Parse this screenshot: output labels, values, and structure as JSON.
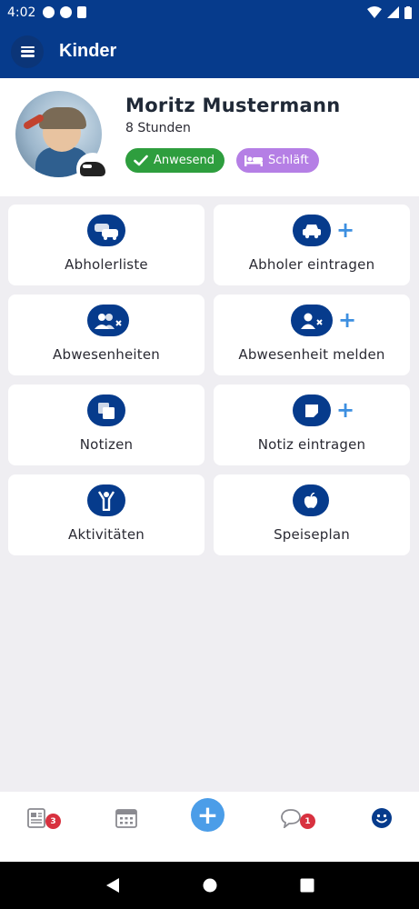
{
  "status_bar": {
    "time": "4:02"
  },
  "app_bar": {
    "title": "Kinder",
    "menu_icon": "menu-icon"
  },
  "profile": {
    "name": "Moritz Mustermann",
    "subtitle": "8 Stunden",
    "status_chips": [
      {
        "label": "Anwesend",
        "icon": "check-icon",
        "color": "#2e9e3e"
      },
      {
        "label": "Schläft",
        "icon": "bed-icon",
        "color": "#b57fe5"
      }
    ]
  },
  "tiles": [
    {
      "label": "Abholerliste",
      "icon": "cars-icon",
      "has_plus": false
    },
    {
      "label": "Abholer eintragen",
      "icon": "car-icon",
      "has_plus": true
    },
    {
      "label": "Abwesenheiten",
      "icon": "users-x-icon",
      "has_plus": false
    },
    {
      "label": "Abwesenheit melden",
      "icon": "user-x-icon",
      "has_plus": true
    },
    {
      "label": "Notizen",
      "icon": "notes-icon",
      "has_plus": false
    },
    {
      "label": "Notiz eintragen",
      "icon": "note-icon",
      "has_plus": true
    },
    {
      "label": "Aktivitäten",
      "icon": "child-activity-icon",
      "has_plus": false
    },
    {
      "label": "Speiseplan",
      "icon": "apple-icon",
      "has_plus": false
    }
  ],
  "bottom_nav": [
    {
      "icon": "newspaper-icon",
      "badge": "3"
    },
    {
      "icon": "calendar-icon",
      "badge": ""
    },
    {
      "icon": "plus-icon",
      "badge": ""
    },
    {
      "icon": "chat-icon",
      "badge": "1"
    },
    {
      "icon": "smiley-icon",
      "badge": ""
    }
  ],
  "colors": {
    "primary": "#063b8c",
    "accent": "#4b9de8",
    "present": "#2e9e3e",
    "sleep": "#b57fe5",
    "badge": "#d8313f"
  }
}
